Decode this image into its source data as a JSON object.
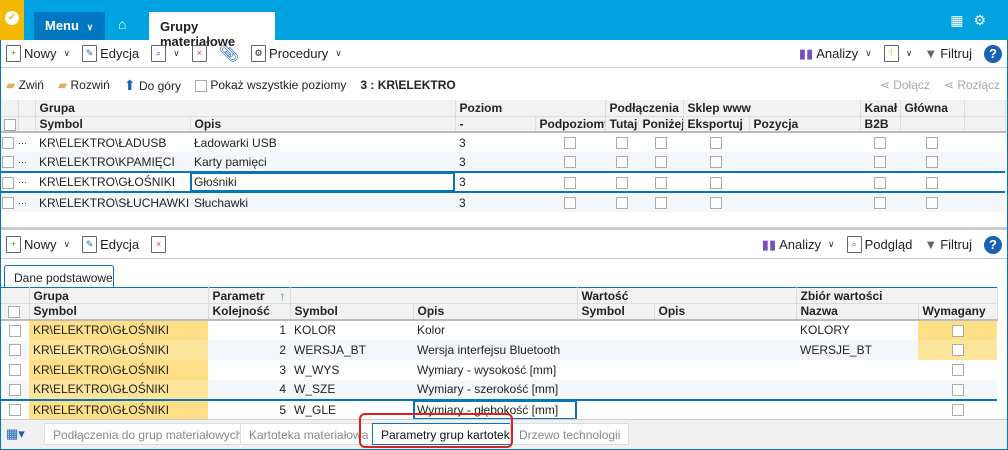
{
  "app": {
    "menu_label": "Menu",
    "active_tab": "Grupy materiałowe"
  },
  "toolbar": {
    "new": "Nowy",
    "edit": "Edycja",
    "procedures": "Procedury",
    "analyses": "Analizy",
    "filter": "Filtruj"
  },
  "subbar": {
    "collapse": "Zwiń",
    "expand": "Rozwiń",
    "up": "Do góry",
    "show_all": "Pokaż wszystkie poziomy",
    "current": "3 : KR\\ELEKTRO",
    "attach": "Dołącz",
    "detach": "Rozłącz"
  },
  "top_grid": {
    "group_headers": {
      "grupa": "Grupa",
      "poziom": "Poziom",
      "podlaczenia": "Podłączenia",
      "sklep": "Sklep www",
      "kanal": "Kanał",
      "glowna": "Główna"
    },
    "columns": {
      "symbol": "Symbol",
      "opis": "Opis",
      "poziom": "-",
      "podpoziomy": "Podpoziomy",
      "tutaj": "Tutaj",
      "ponizej": "Poniżej",
      "eksportuj": "Eksportuj",
      "pozycja": "Pozycja",
      "b2b": "B2B"
    },
    "rows": [
      {
        "symbol": "KR\\ELEKTRO\\ŁADUSB",
        "opis": "Ładowarki USB",
        "poziom": "3"
      },
      {
        "symbol": "KR\\ELEKTRO\\KPAMIĘCI",
        "opis": "Karty pamięci",
        "poziom": "3"
      },
      {
        "symbol": "KR\\ELEKTRO\\GŁOŚNIKI",
        "opis": "Głośniki",
        "poziom": "3"
      },
      {
        "symbol": "KR\\ELEKTRO\\SŁUCHAWKI",
        "opis": "Słuchawki",
        "poziom": "3"
      }
    ]
  },
  "bottom_toolbar": {
    "new": "Nowy",
    "edit": "Edycja",
    "analyses": "Analizy",
    "preview": "Podgląd",
    "filter": "Filtruj"
  },
  "bottom_tab": "Dane podstawowe",
  "bottom_grid": {
    "group_headers": {
      "grupa": "Grupa",
      "parametr": "Parametr",
      "wartosc": "Wartość",
      "zbior": "Zbiór wartości"
    },
    "columns": {
      "symbol": "Symbol",
      "kolejnosc": "Kolejność",
      "psymbol": "Symbol",
      "opis": "Opis",
      "wsymbol": "Symbol",
      "wopis": "Opis",
      "nazwa": "Nazwa",
      "wymagany": "Wymagany"
    },
    "rows": [
      {
        "grupa": "KR\\ELEKTRO\\GŁOŚNIKI",
        "kolejnosc": "1",
        "symbol": "KOLOR",
        "opis": "Kolor",
        "nazwa": "KOLORY"
      },
      {
        "grupa": "KR\\ELEKTRO\\GŁOŚNIKI",
        "kolejnosc": "2",
        "symbol": "WERSJA_BT",
        "opis": "Wersja interfejsu Bluetooth",
        "nazwa": "WERSJE_BT"
      },
      {
        "grupa": "KR\\ELEKTRO\\GŁOŚNIKI",
        "kolejnosc": "3",
        "symbol": "W_WYS",
        "opis": "Wymiary - wysokość [mm]",
        "nazwa": ""
      },
      {
        "grupa": "KR\\ELEKTRO\\GŁOŚNIKI",
        "kolejnosc": "4",
        "symbol": "W_SZE",
        "opis": "Wymiary - szerokość [mm]",
        "nazwa": ""
      },
      {
        "grupa": "KR\\ELEKTRO\\GŁOŚNIKI",
        "kolejnosc": "5",
        "symbol": "W_GLE",
        "opis": "Wymiary - głębokość [mm]",
        "nazwa": ""
      }
    ]
  },
  "bottom_tabs": [
    "Podłączenia do grup materiałowych",
    "Kartoteka materiałowa",
    "Parametry grup kartotek",
    "Drzewo technologii"
  ]
}
